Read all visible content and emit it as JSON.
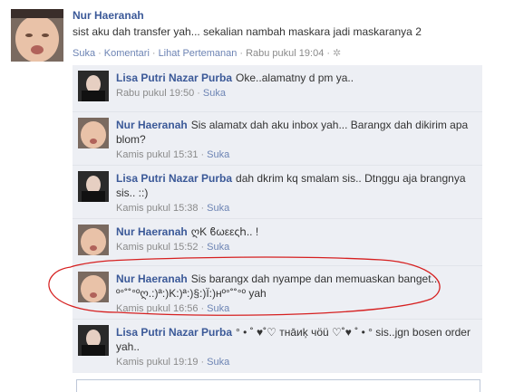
{
  "post": {
    "author": "Nur Haeranah",
    "text": "sist aku dah transfer yah... sekalian nambah maskara jadi maskaranya 2",
    "actions": {
      "like": "Suka",
      "comment": "Komentari",
      "see_friendship": "Lihat Pertemanan",
      "timestamp": "Rabu pukul 19:04"
    }
  },
  "comments": [
    {
      "author": "Lisa Putri Nazar Purba",
      "text": "Oke..alamatny d pm ya..",
      "timestamp": "Rabu pukul 19:50",
      "like": "Suka",
      "avatar": "woman"
    },
    {
      "author": "Nur Haeranah",
      "text": "Sis alamatx dah aku inbox yah... Barangx dah dikirim apa blom?",
      "timestamp": "Kamis pukul 15:31",
      "like": "Suka",
      "avatar": "baby"
    },
    {
      "author": "Lisa Putri Nazar Purba",
      "text": "dah dkrim kq smalam sis.. Dtnggu aja brangnya sis.. ::)",
      "timestamp": "Kamis pukul 15:38",
      "like": "Suka",
      "avatar": "woman"
    },
    {
      "author": "Nur Haeranah",
      "text": "ღK ϐωεεςհ.. !",
      "timestamp": "Kamis pukul 15:52",
      "like": "Suka",
      "avatar": "baby"
    },
    {
      "author": "Nur Haeranah",
      "text": "Sis barangx dah nyampe dan memuaskan banget... º°˚˚°ºღ.:)ª:)K:)ª:)§:)Ï:)ʜº°˚˚°º yah",
      "timestamp": "Kamis pukul 16:56",
      "like": "Suka",
      "avatar": "baby"
    },
    {
      "author": "Lisa Putri Nazar Purba",
      "text": "° • ˚ ♥˚♡ тнāиķ чöü ♡˚♥ ˚ • ° sis..jgn bosen order yah..",
      "timestamp": "Kamis pukul 19:19",
      "like": "Suka",
      "avatar": "woman"
    }
  ],
  "colors": {
    "link": "#3b5998",
    "meta": "#8a8a8a",
    "comment_bg": "#edeff4",
    "annotation": "#d62020"
  }
}
